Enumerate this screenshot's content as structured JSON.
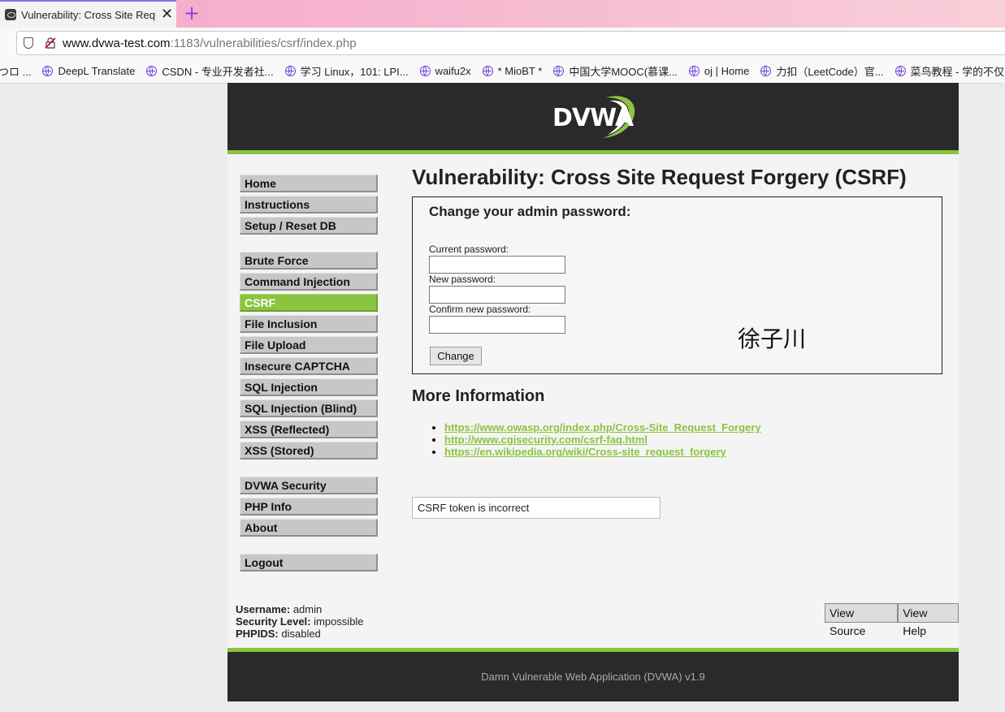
{
  "browser": {
    "tab_title": "Vulnerability: Cross Site Request Forgery (CSRF)",
    "tab_close": "✕",
    "new_tab": "+",
    "url_host": "www.dvwa-test.com",
    "url_rest": ":1183/vulnerabilities/csrf/index.php",
    "bookmarks": [
      "つロ ...",
      "DeepL Translate",
      "CSDN - 专业开发者社...",
      "学习 Linux，101: LPI...",
      "waifu2x",
      "* MioBT *",
      "中国大学MOOC(慕课...",
      "oj | Home",
      "力扣（LeetCode）官...",
      "菜鸟教程 - 学的不仅..."
    ]
  },
  "header": {
    "logo_text": "DVWA"
  },
  "menu": {
    "group1": [
      "Home",
      "Instructions",
      "Setup / Reset DB"
    ],
    "group2": [
      "Brute Force",
      "Command Injection",
      "CSRF",
      "File Inclusion",
      "File Upload",
      "Insecure CAPTCHA",
      "SQL Injection",
      "SQL Injection (Blind)",
      "XSS (Reflected)",
      "XSS (Stored)"
    ],
    "group3": [
      "DVWA Security",
      "PHP Info",
      "About"
    ],
    "group4": [
      "Logout"
    ],
    "selected": "CSRF"
  },
  "main": {
    "title": "Vulnerability: Cross Site Request Forgery (CSRF)",
    "form_heading": "Change your admin password:",
    "current_label": "Current password:",
    "new_label": "New password:",
    "confirm_label": "Confirm new password:",
    "change_button": "Change",
    "watermark": "徐子川",
    "more_info_heading": "More Information",
    "links": [
      "https://www.owasp.org/index.php/Cross-Site_Request_Forgery",
      "http://www.cgisecurity.com/csrf-faq.html",
      "https://en.wikipedia.org/wiki/Cross-site_request_forgery"
    ],
    "message": "CSRF token is incorrect"
  },
  "user_info": {
    "username_label": "Username:",
    "username": "admin",
    "security_label": "Security Level:",
    "security": "impossible",
    "phpids_label": "PHPIDS:",
    "phpids": "disabled"
  },
  "buttons": {
    "view_source": "View Source",
    "view_help": "View Help"
  },
  "footer": {
    "text": "Damn Vulnerable Web Application (DVWA) v1.9"
  },
  "colors": {
    "accent_green": "#8bc43f",
    "header_bg": "#2a2a2a",
    "tab_accent": "#7b46e6"
  }
}
